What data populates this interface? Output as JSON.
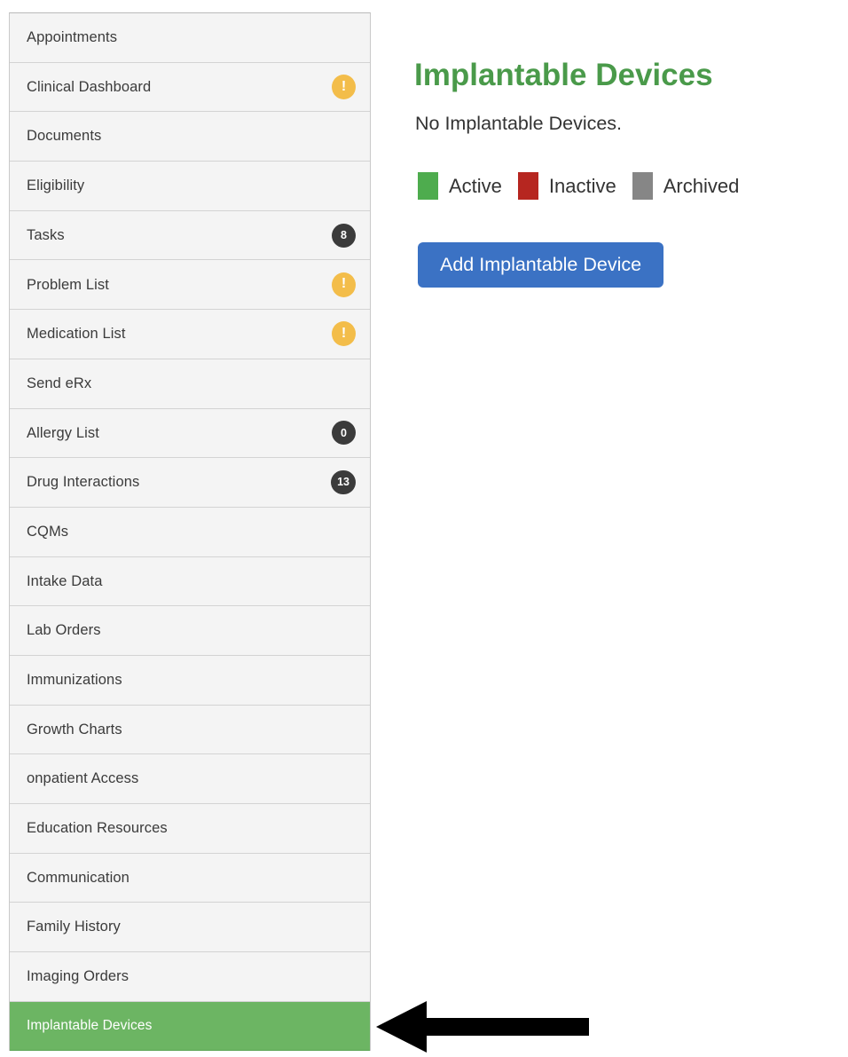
{
  "sidebar": {
    "items": [
      {
        "label": "Appointments",
        "badge": null,
        "selected": false
      },
      {
        "label": "Clinical Dashboard",
        "badge": {
          "type": "warn",
          "text": "!"
        },
        "selected": false
      },
      {
        "label": "Documents",
        "badge": null,
        "selected": false
      },
      {
        "label": "Eligibility",
        "badge": null,
        "selected": false
      },
      {
        "label": "Tasks",
        "badge": {
          "type": "count",
          "text": "8"
        },
        "selected": false
      },
      {
        "label": "Problem List",
        "badge": {
          "type": "warn",
          "text": "!"
        },
        "selected": false
      },
      {
        "label": "Medication List",
        "badge": {
          "type": "warn",
          "text": "!"
        },
        "selected": false
      },
      {
        "label": "Send eRx",
        "badge": null,
        "selected": false
      },
      {
        "label": "Allergy List",
        "badge": {
          "type": "count",
          "text": "0"
        },
        "selected": false
      },
      {
        "label": "Drug Interactions",
        "badge": {
          "type": "count",
          "text": "13"
        },
        "selected": false
      },
      {
        "label": "CQMs",
        "badge": null,
        "selected": false
      },
      {
        "label": "Intake Data",
        "badge": null,
        "selected": false
      },
      {
        "label": "Lab Orders",
        "badge": null,
        "selected": false
      },
      {
        "label": "Immunizations",
        "badge": null,
        "selected": false
      },
      {
        "label": "Growth Charts",
        "badge": null,
        "selected": false
      },
      {
        "label": "onpatient Access",
        "badge": null,
        "selected": false
      },
      {
        "label": "Education Resources",
        "badge": null,
        "selected": false
      },
      {
        "label": "Communication",
        "badge": null,
        "selected": false
      },
      {
        "label": "Family History",
        "badge": null,
        "selected": false
      },
      {
        "label": "Imaging Orders",
        "badge": null,
        "selected": false
      },
      {
        "label": "Implantable Devices",
        "badge": null,
        "selected": true
      }
    ]
  },
  "main": {
    "title": "Implantable Devices",
    "empty_message": "No Implantable Devices.",
    "legend": [
      {
        "label": "Active",
        "color": "#4eac4e"
      },
      {
        "label": "Inactive",
        "color": "#b62620"
      },
      {
        "label": "Archived",
        "color": "#868686"
      }
    ],
    "add_button_label": "Add Implantable Device"
  },
  "annotation": {
    "arrow_icon": "left-arrow-icon",
    "arrow_color": "#000000"
  },
  "colors": {
    "selected_row": "#6cb563",
    "title_green": "#4a9a4a",
    "button_blue": "#3b72c4",
    "warn_badge": "#f3bd4a",
    "count_badge": "#3b3b3b",
    "row_background": "#f4f4f4"
  }
}
